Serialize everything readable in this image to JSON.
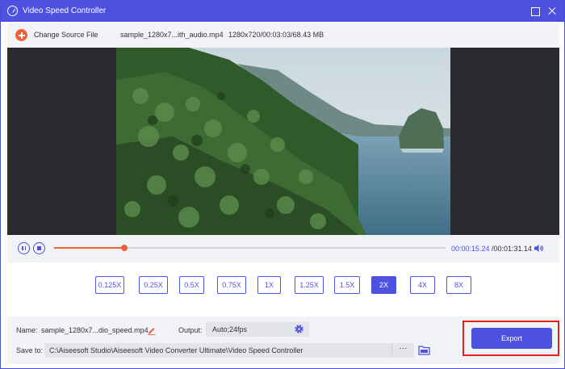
{
  "window": {
    "title": "Video Speed Controller",
    "accent_color": "#4e51e0"
  },
  "source": {
    "change_label": "Change Source File",
    "file_name": "sample_1280x7...ith_audio.mp4",
    "file_info": "1280x720/00:03:03/68.43 MB"
  },
  "playback": {
    "progress": 0.18,
    "current_time": "00:00:15.24",
    "total_time": "/00:01:31.14"
  },
  "speed": {
    "options": [
      "0.125X",
      "0.25X",
      "0.5X",
      "0.75X",
      "1X",
      "1.25X",
      "1.5X",
      "2X",
      "4X",
      "8X"
    ],
    "selected": "2X"
  },
  "output": {
    "name_label": "Name:",
    "name_value": "sample_1280x7...dio_speed.mp4",
    "output_label": "Output:",
    "output_value": "Auto;24fps",
    "save_label": "Save to:",
    "save_path": "C:\\Aiseesoft Studio\\Aiseesoft Video Converter Ultimate\\Video Speed Controller",
    "browse_label": "···",
    "export_label": "Export"
  }
}
